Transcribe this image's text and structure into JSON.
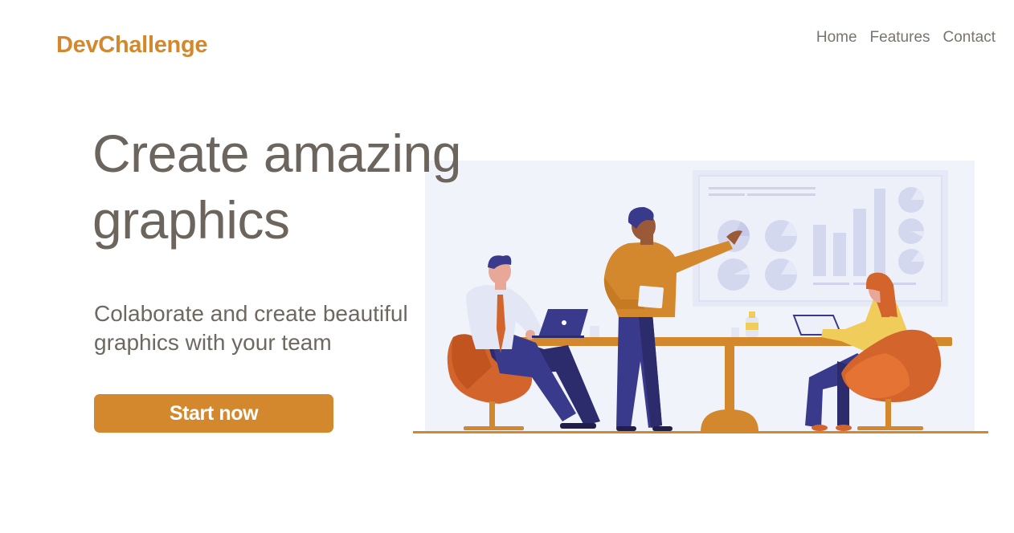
{
  "brand": {
    "name": "DevChallenge",
    "color": "#d4882d"
  },
  "nav": {
    "items": [
      {
        "label": "Home"
      },
      {
        "label": "Features"
      },
      {
        "label": "Contact"
      }
    ]
  },
  "hero": {
    "title_line1": "Create amazing",
    "title_line2": "graphics",
    "subtitle_line1": "Colaborate and create beautiful",
    "subtitle_line2": "graphics with your team",
    "cta_label": "Start now"
  },
  "colors": {
    "accent": "#d4882d",
    "heading": "#6c655e",
    "text": "#6e6861",
    "nav": "#7a746c",
    "illustration_bg": "#f1f3fb",
    "navy": "#2f2f70",
    "chair": "#d3642c"
  },
  "illustration": {
    "icon": "team-meeting-illustration"
  }
}
